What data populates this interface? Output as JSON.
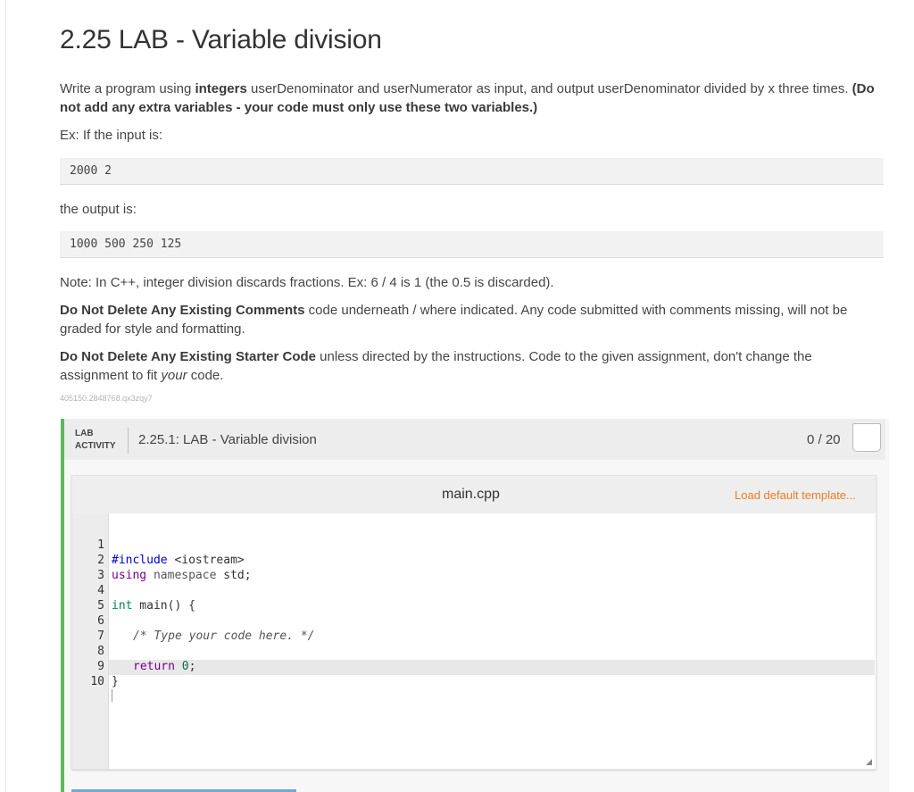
{
  "page": {
    "title": "2.25 LAB - Variable division",
    "intro_1": "Write a program using ",
    "intro_bold": "integers",
    "intro_2": " userDenominator and userNumerator as input, and output userDenominator divided by x three times. ",
    "intro_bold2": "(Do not add any extra variables - your code must only use these two variables.)",
    "ex_label": "Ex: If the input is:",
    "ex_input": "2000 2",
    "output_label": "the output is:",
    "ex_output": "1000 500 250 125",
    "note": "Note: In C++, integer division discards fractions. Ex: 6 / 4 is 1 (the 0.5 is discarded).",
    "rule1_bold": "Do Not Delete Any Existing Comments",
    "rule1_rest": " code underneath / where indicated. Any code submitted with comments missing, will not be graded for style and formatting.",
    "rule2_bold": "Do Not Delete Any Existing Starter Code",
    "rule2_rest": " unless directed by the instructions. Code to the given assignment, don't change the assignment to fit ",
    "rule2_em": "your",
    "rule2_end": " code.",
    "stamp": "405150.2848768.qx3zqy7"
  },
  "lab": {
    "tag_line1": "LAB",
    "tag_line2": "ACTIVITY",
    "title": "2.25.1: LAB - Variable division",
    "score": "0 / 20",
    "accent": "#5cb85c"
  },
  "editor": {
    "filename": "main.cpp",
    "load_template": "Load default template...",
    "line_numbers": [
      "1",
      "2",
      "3",
      "4",
      "5",
      "6",
      "7",
      "8",
      "9",
      "10"
    ],
    "code": {
      "l1_kw": "#include",
      "l1_rest": " <iostream>",
      "l2_kw": "using",
      "l2_ns": " namespace",
      "l2_rest": " std;",
      "l4_type": "int",
      "l4_fn": " main()",
      "l4_brace": " {",
      "l6_comment": "/* Type your code here. */",
      "l8_kw": "return",
      "l8_num": " 0",
      "l8_semi": ";",
      "l9_brace": "}"
    }
  }
}
